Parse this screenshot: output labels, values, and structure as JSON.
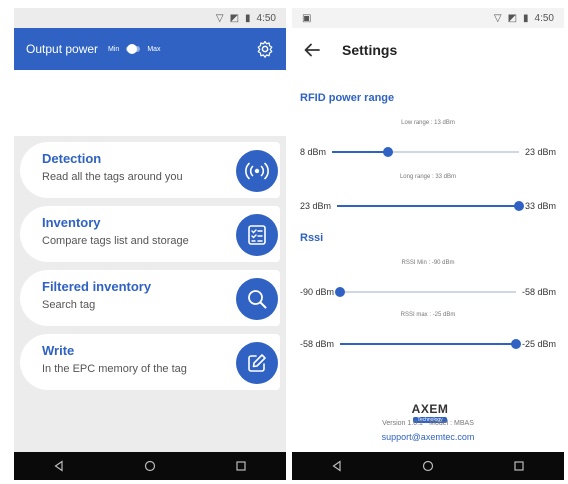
{
  "left": {
    "status_time": "4:50",
    "appbar": {
      "title": "Output power",
      "min_label": "Min",
      "max_label": "Max"
    },
    "menu": [
      {
        "title": "Detection",
        "subtitle": "Read all the tags around you",
        "icon": "radio-waves-icon"
      },
      {
        "title": "Inventory",
        "subtitle": "Compare tags list and storage",
        "icon": "checklist-icon"
      },
      {
        "title": "Filtered inventory",
        "subtitle": "Search tag",
        "icon": "search-icon"
      },
      {
        "title": "Write",
        "subtitle": "In the EPC memory of the tag",
        "icon": "edit-icon"
      }
    ]
  },
  "right": {
    "status_time": "4:50",
    "title": "Settings",
    "rfid": {
      "heading": "RFID power range",
      "low": {
        "caption": "Low range : 13 dBm",
        "min": "8 dBm",
        "max": "23 dBm",
        "value_fraction": 0.3
      },
      "long": {
        "caption": "Long range : 33 dBm",
        "min": "23 dBm",
        "max": "33 dBm",
        "value_fraction": 1.0
      }
    },
    "rssi": {
      "heading": "Rssi",
      "min": {
        "caption": "RSSI Min : -90 dBm",
        "min": "-90 dBm",
        "max": "-58 dBm",
        "value_fraction": 0.0
      },
      "max": {
        "caption": "RSSI max : -25 dBm",
        "min": "-58 dBm",
        "max": "-25 dBm",
        "value_fraction": 1.0
      }
    },
    "footer": {
      "logo_text": "AXEM",
      "logo_sub": "Technology",
      "version": "Version 1.0.1 - Model : MBAS",
      "email": "support@axemtec.com"
    }
  },
  "colors": {
    "accent": "#2f62c2",
    "nav_bar": "#0a0a0a"
  }
}
